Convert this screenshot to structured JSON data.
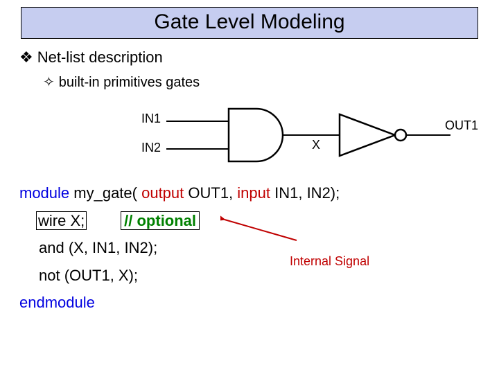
{
  "title": "Gate Level Modeling",
  "bullet1": "Net-list description",
  "bullet2": "built-in primitives gates",
  "labels": {
    "in1": "IN1",
    "in2": "IN2",
    "x": "X",
    "out1": "OUT1"
  },
  "code": {
    "module_kw": "module",
    "module_name": " my_gate( ",
    "output_kw": "output",
    "output_sig": " OUT1,  ",
    "input_kw": "input",
    "input_sig": " IN1, IN2);",
    "wire_decl": "wire X;",
    "comment": "// optional",
    "and_stmt": "and  (X, IN1, IN2);",
    "not_stmt": "not (OUT1, X);",
    "endmodule": "endmodule"
  },
  "annotation": "Internal Signal"
}
